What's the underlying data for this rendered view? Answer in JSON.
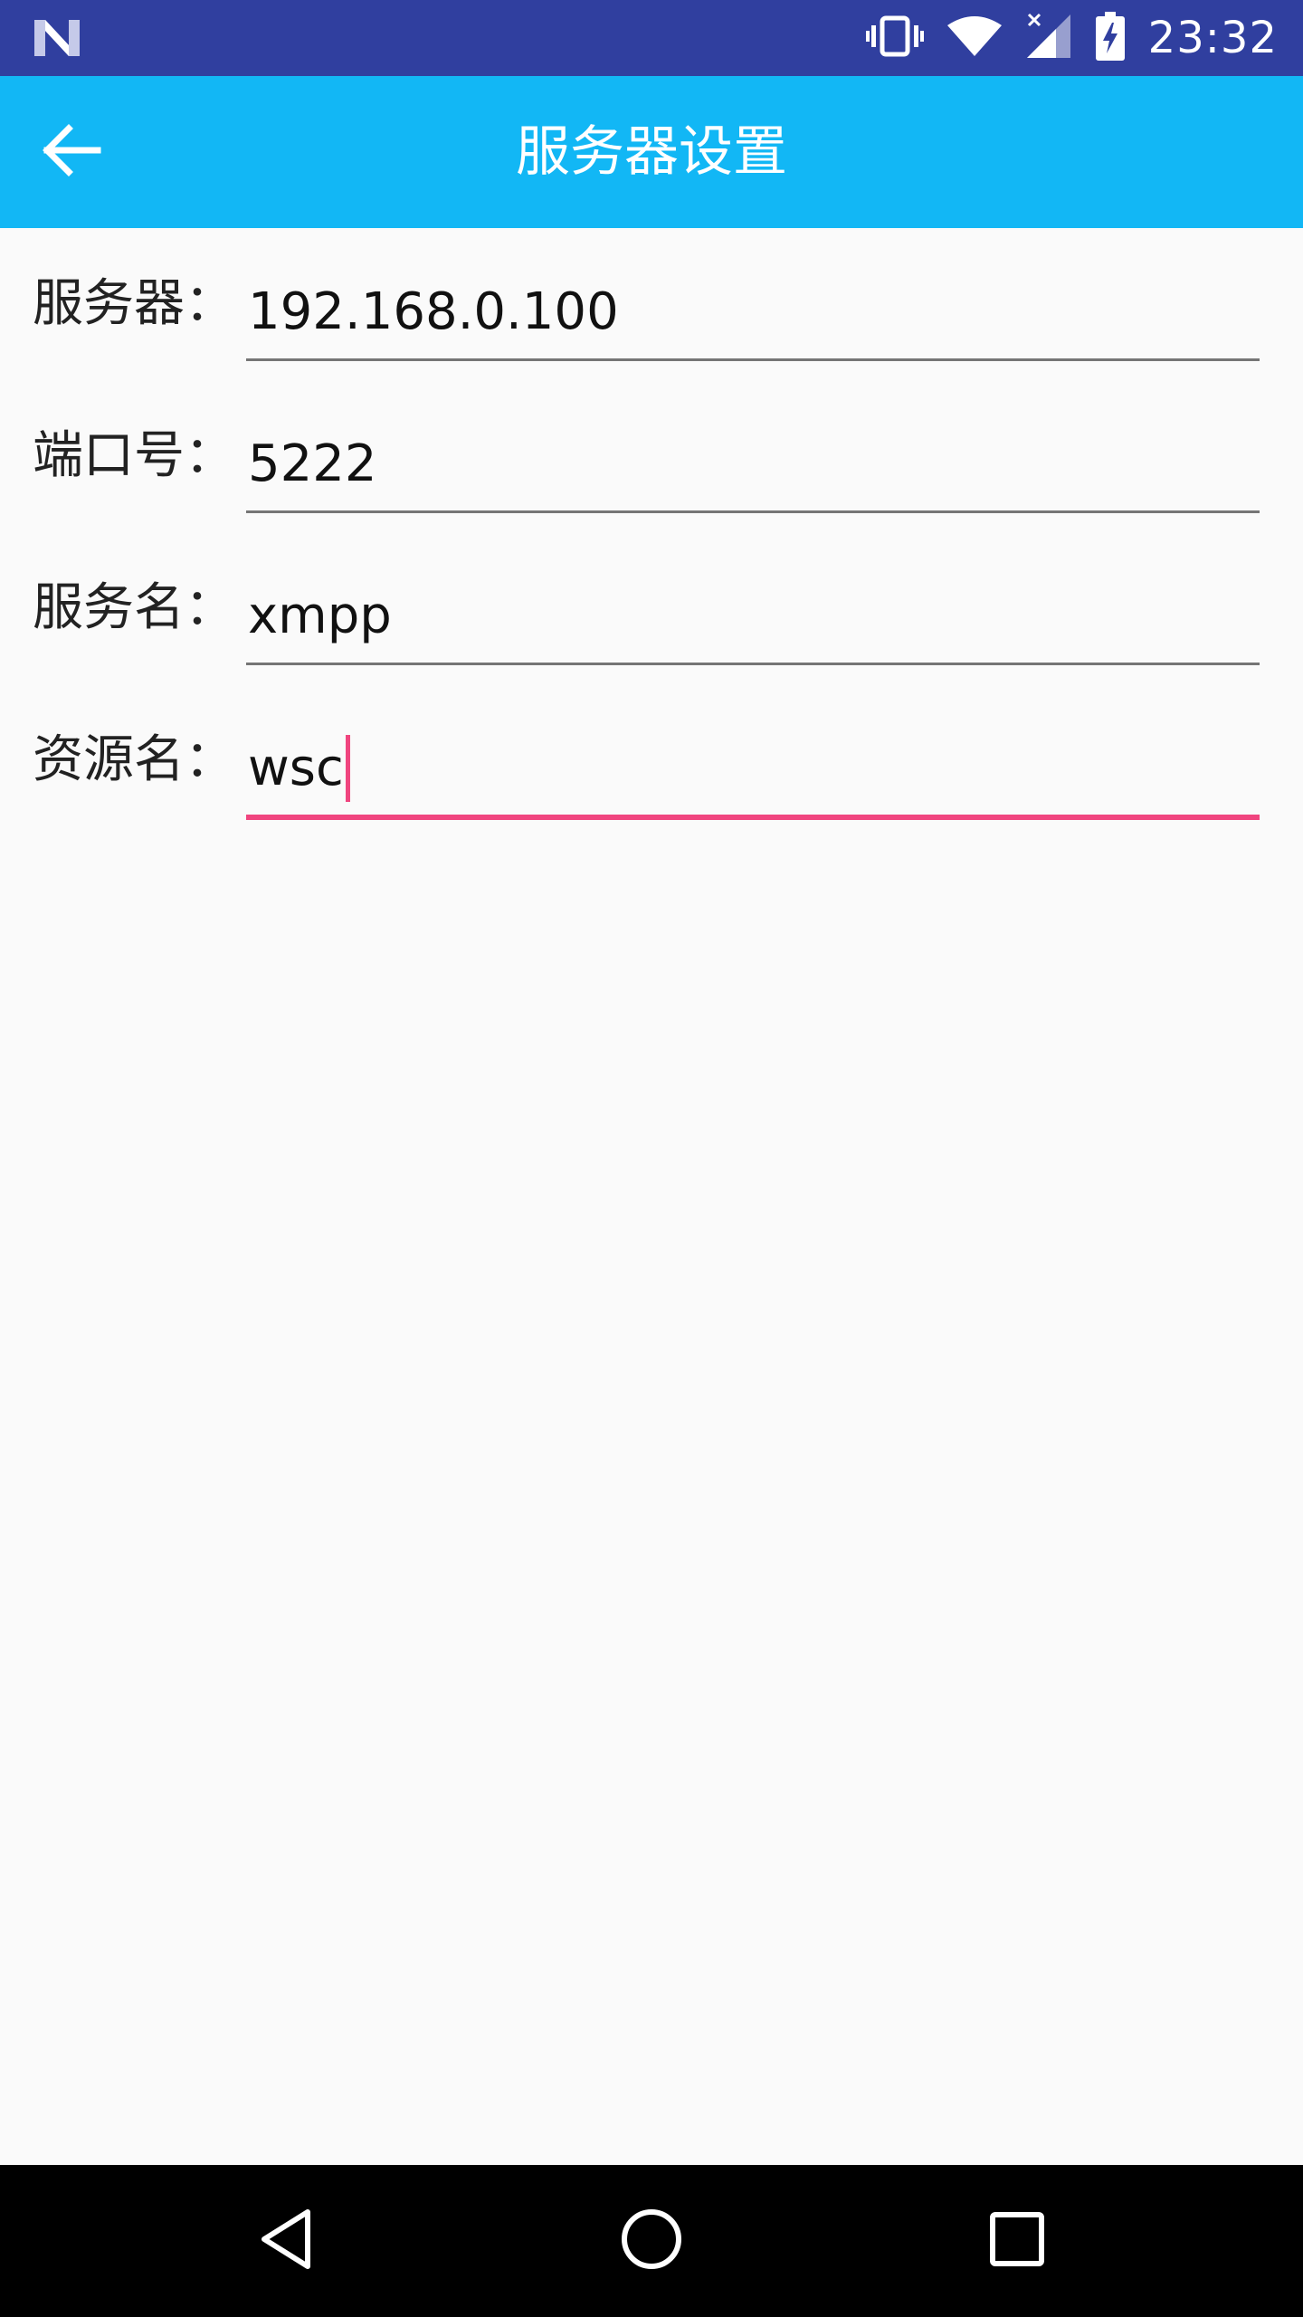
{
  "status_bar": {
    "time": "23:32",
    "icons": [
      "notification-n-icon",
      "vibrate-icon",
      "wifi-icon",
      "signal-icon",
      "battery-charging-icon"
    ]
  },
  "toolbar": {
    "back_icon": "back-arrow-icon",
    "title": "服务器设置"
  },
  "form": {
    "fields": [
      {
        "label": "服务器：",
        "value": "192.168.0.100",
        "focused": false
      },
      {
        "label": "端口号：",
        "value": "5222",
        "focused": false
      },
      {
        "label": "服务名：",
        "value": "xmpp",
        "focused": false
      },
      {
        "label": "资源名：",
        "value": "wsc",
        "focused": true
      }
    ]
  },
  "nav_bar": {
    "icons": [
      "back-triangle-icon",
      "home-circle-icon",
      "recents-square-icon"
    ]
  },
  "colors": {
    "status_bar": "#303f9f",
    "toolbar": "#12b7f5",
    "accent": "#f0457f",
    "background": "#fafafa"
  }
}
